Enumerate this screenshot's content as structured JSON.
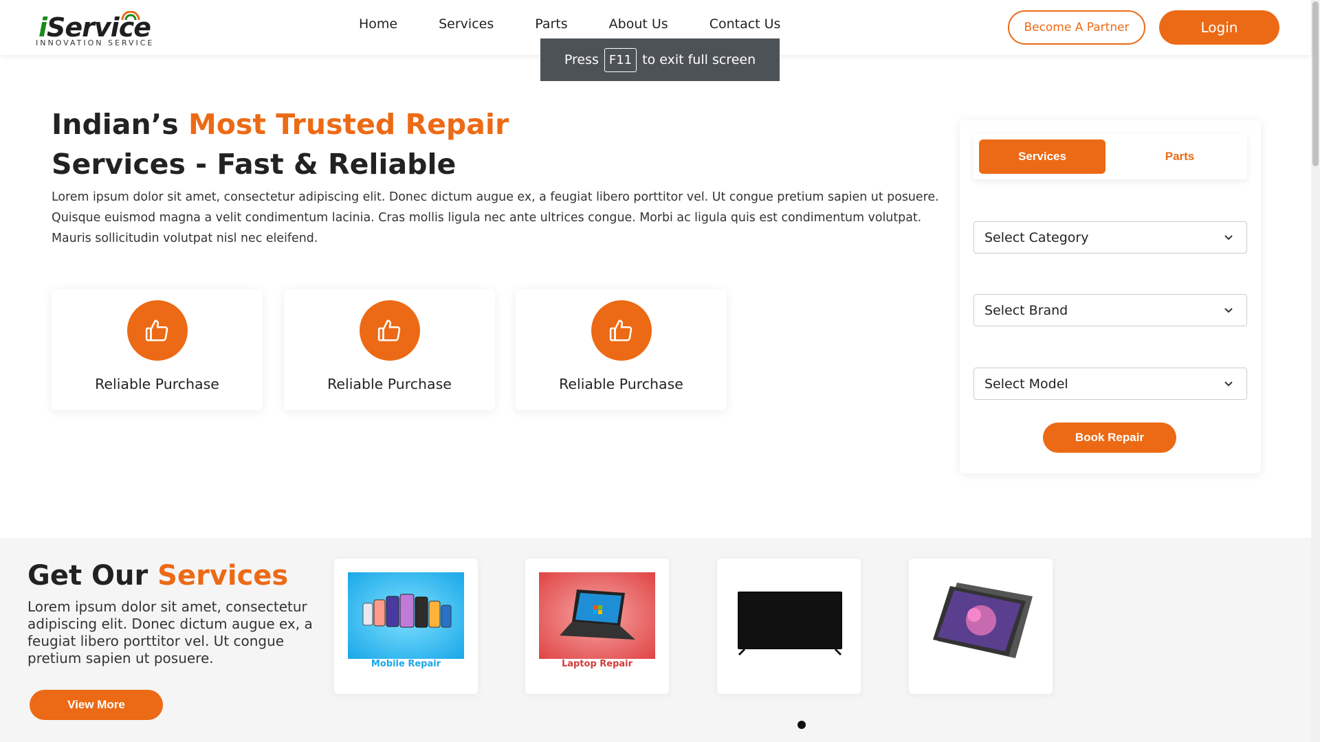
{
  "logo": {
    "text_first": "i",
    "text_rest": "Service",
    "tagline": "INNOVATION SERVICE"
  },
  "nav": [
    "Home",
    "Services",
    "Parts",
    "About Us",
    "Contact Us"
  ],
  "header": {
    "partner_label": "Become A Partner",
    "login_label": "Login"
  },
  "fullscreen_toast": {
    "before": "Press",
    "key": "F11",
    "after": "to exit full screen"
  },
  "hero": {
    "title_prefix": "Indian’s ",
    "title_accent": "Most Trusted Repair",
    "title_line2": "Services - Fast & Reliable",
    "description": "Lorem ipsum dolor sit amet, consectetur adipiscing elit. Donec dictum augue ex, a feugiat libero porttitor vel. Ut congue pretium sapien ut posuere. Quisque euismod magna a velit condimentum lacinia. Cras mollis ligula nec ante ultrices congue. Morbi ac ligula quis est condimentum volutpat. Mauris sollicitudin volutpat nisl nec eleifend.",
    "features": [
      {
        "label": "Reliable Purchase",
        "icon": "thumbs-up-icon"
      },
      {
        "label": "Reliable Purchase",
        "icon": "thumbs-up-icon"
      },
      {
        "label": "Reliable Purchase",
        "icon": "thumbs-up-icon"
      }
    ]
  },
  "booking": {
    "tab_services": "Services",
    "tab_parts": "Parts",
    "select_category": "Select Category",
    "select_brand": "Select Brand",
    "select_model": "Select Model",
    "book_label": "Book Repair"
  },
  "services": {
    "title_prefix": "Get Our ",
    "title_accent": "Services",
    "description": "Lorem ipsum dolor sit amet, consectetur adipiscing elit. Donec dictum augue ex, a feugiat libero porttitor vel. Ut congue pretium sapien ut posuere.",
    "view_more": "View More",
    "cards": [
      {
        "caption": "Mobile Repair",
        "image": "mobile-phones-image"
      },
      {
        "caption": "Laptop Repair",
        "image": "laptop-image"
      },
      {
        "caption": "",
        "image": "television-image"
      },
      {
        "caption": "",
        "image": "tablet-image"
      }
    ]
  },
  "colors": {
    "accent": "#ec6a15",
    "logo_green": "#1a8a1a",
    "toast_bg": "#4d5257"
  }
}
